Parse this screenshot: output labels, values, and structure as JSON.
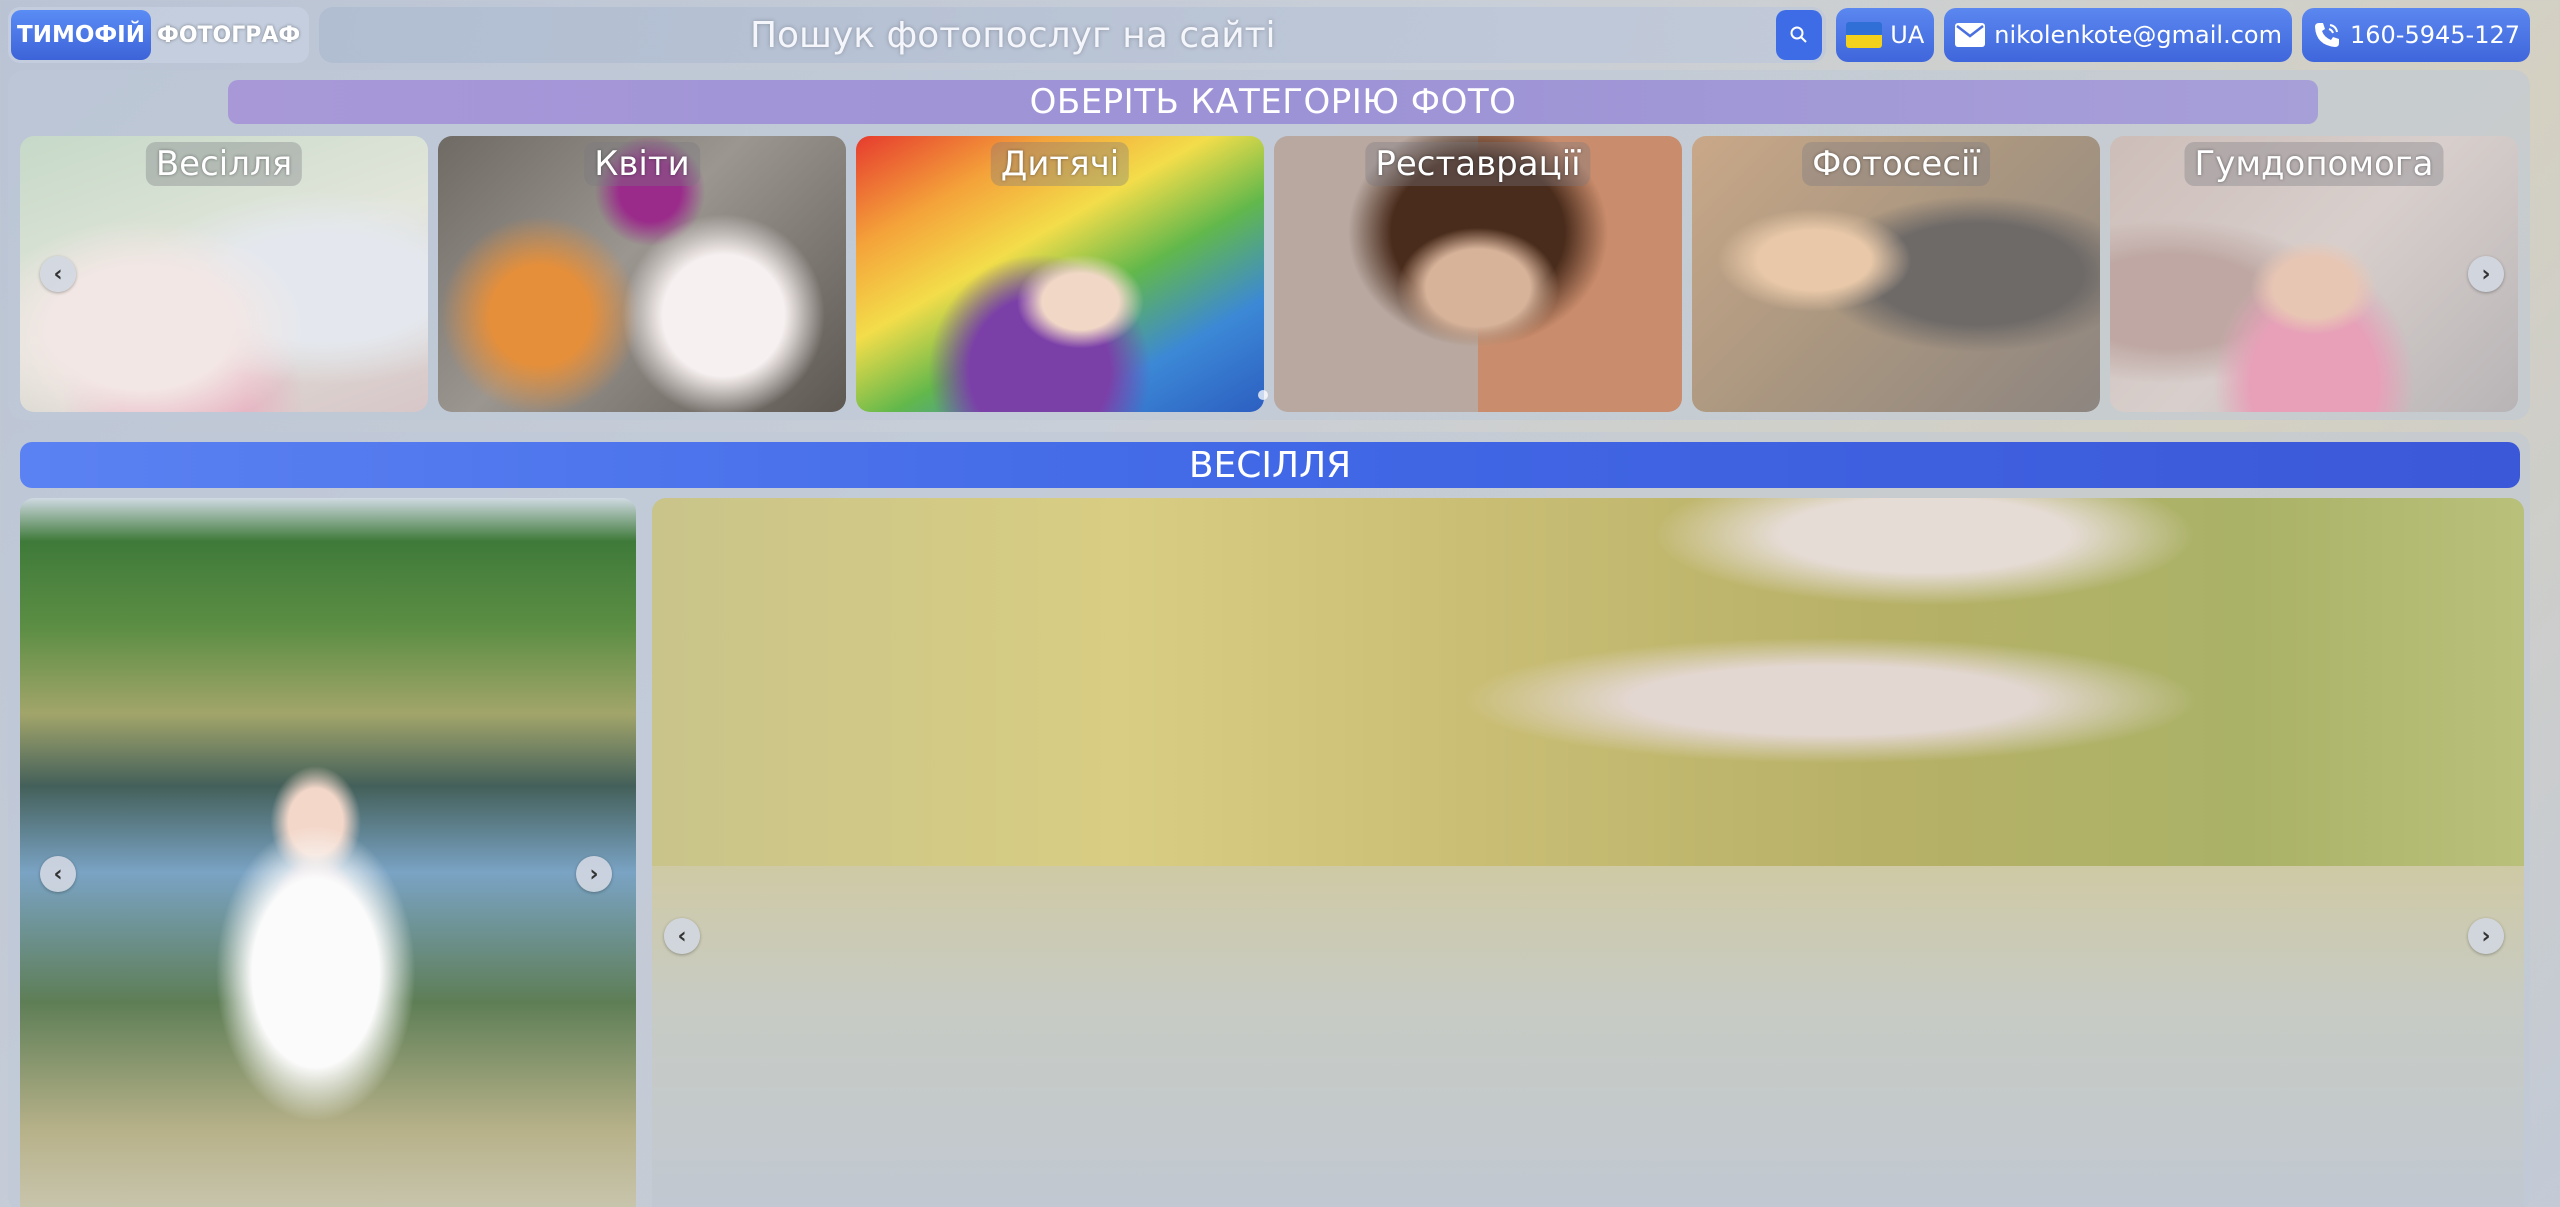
{
  "header": {
    "brand_primary": "ТИМОФІЙ",
    "brand_secondary": "ФОТОГРАФ",
    "search_placeholder": "Пошук фотопослуг на сайті",
    "language": "UA",
    "email": "nikolenkote@gmail.com",
    "phone": "160-5945-127",
    "flag_colors": [
      "#2f6fd6",
      "#f4d21c"
    ],
    "icons": [
      "search-icon",
      "mail-icon",
      "phone-icon",
      "ua-flag-icon"
    ]
  },
  "categories": {
    "title": "ОБЕРІТЬ КАТЕГОРІЮ ФОТО",
    "items": [
      {
        "label": "Весілля"
      },
      {
        "label": "Квіти"
      },
      {
        "label": "Дитячі"
      },
      {
        "label": "Реставрації"
      },
      {
        "label": "Фотосесії"
      },
      {
        "label": "Гумдопомога"
      }
    ]
  },
  "section": {
    "title": "ВЕСІЛЛЯ"
  },
  "colors": {
    "accent": "#4168e6",
    "category_bar": "#9c92d6"
  }
}
